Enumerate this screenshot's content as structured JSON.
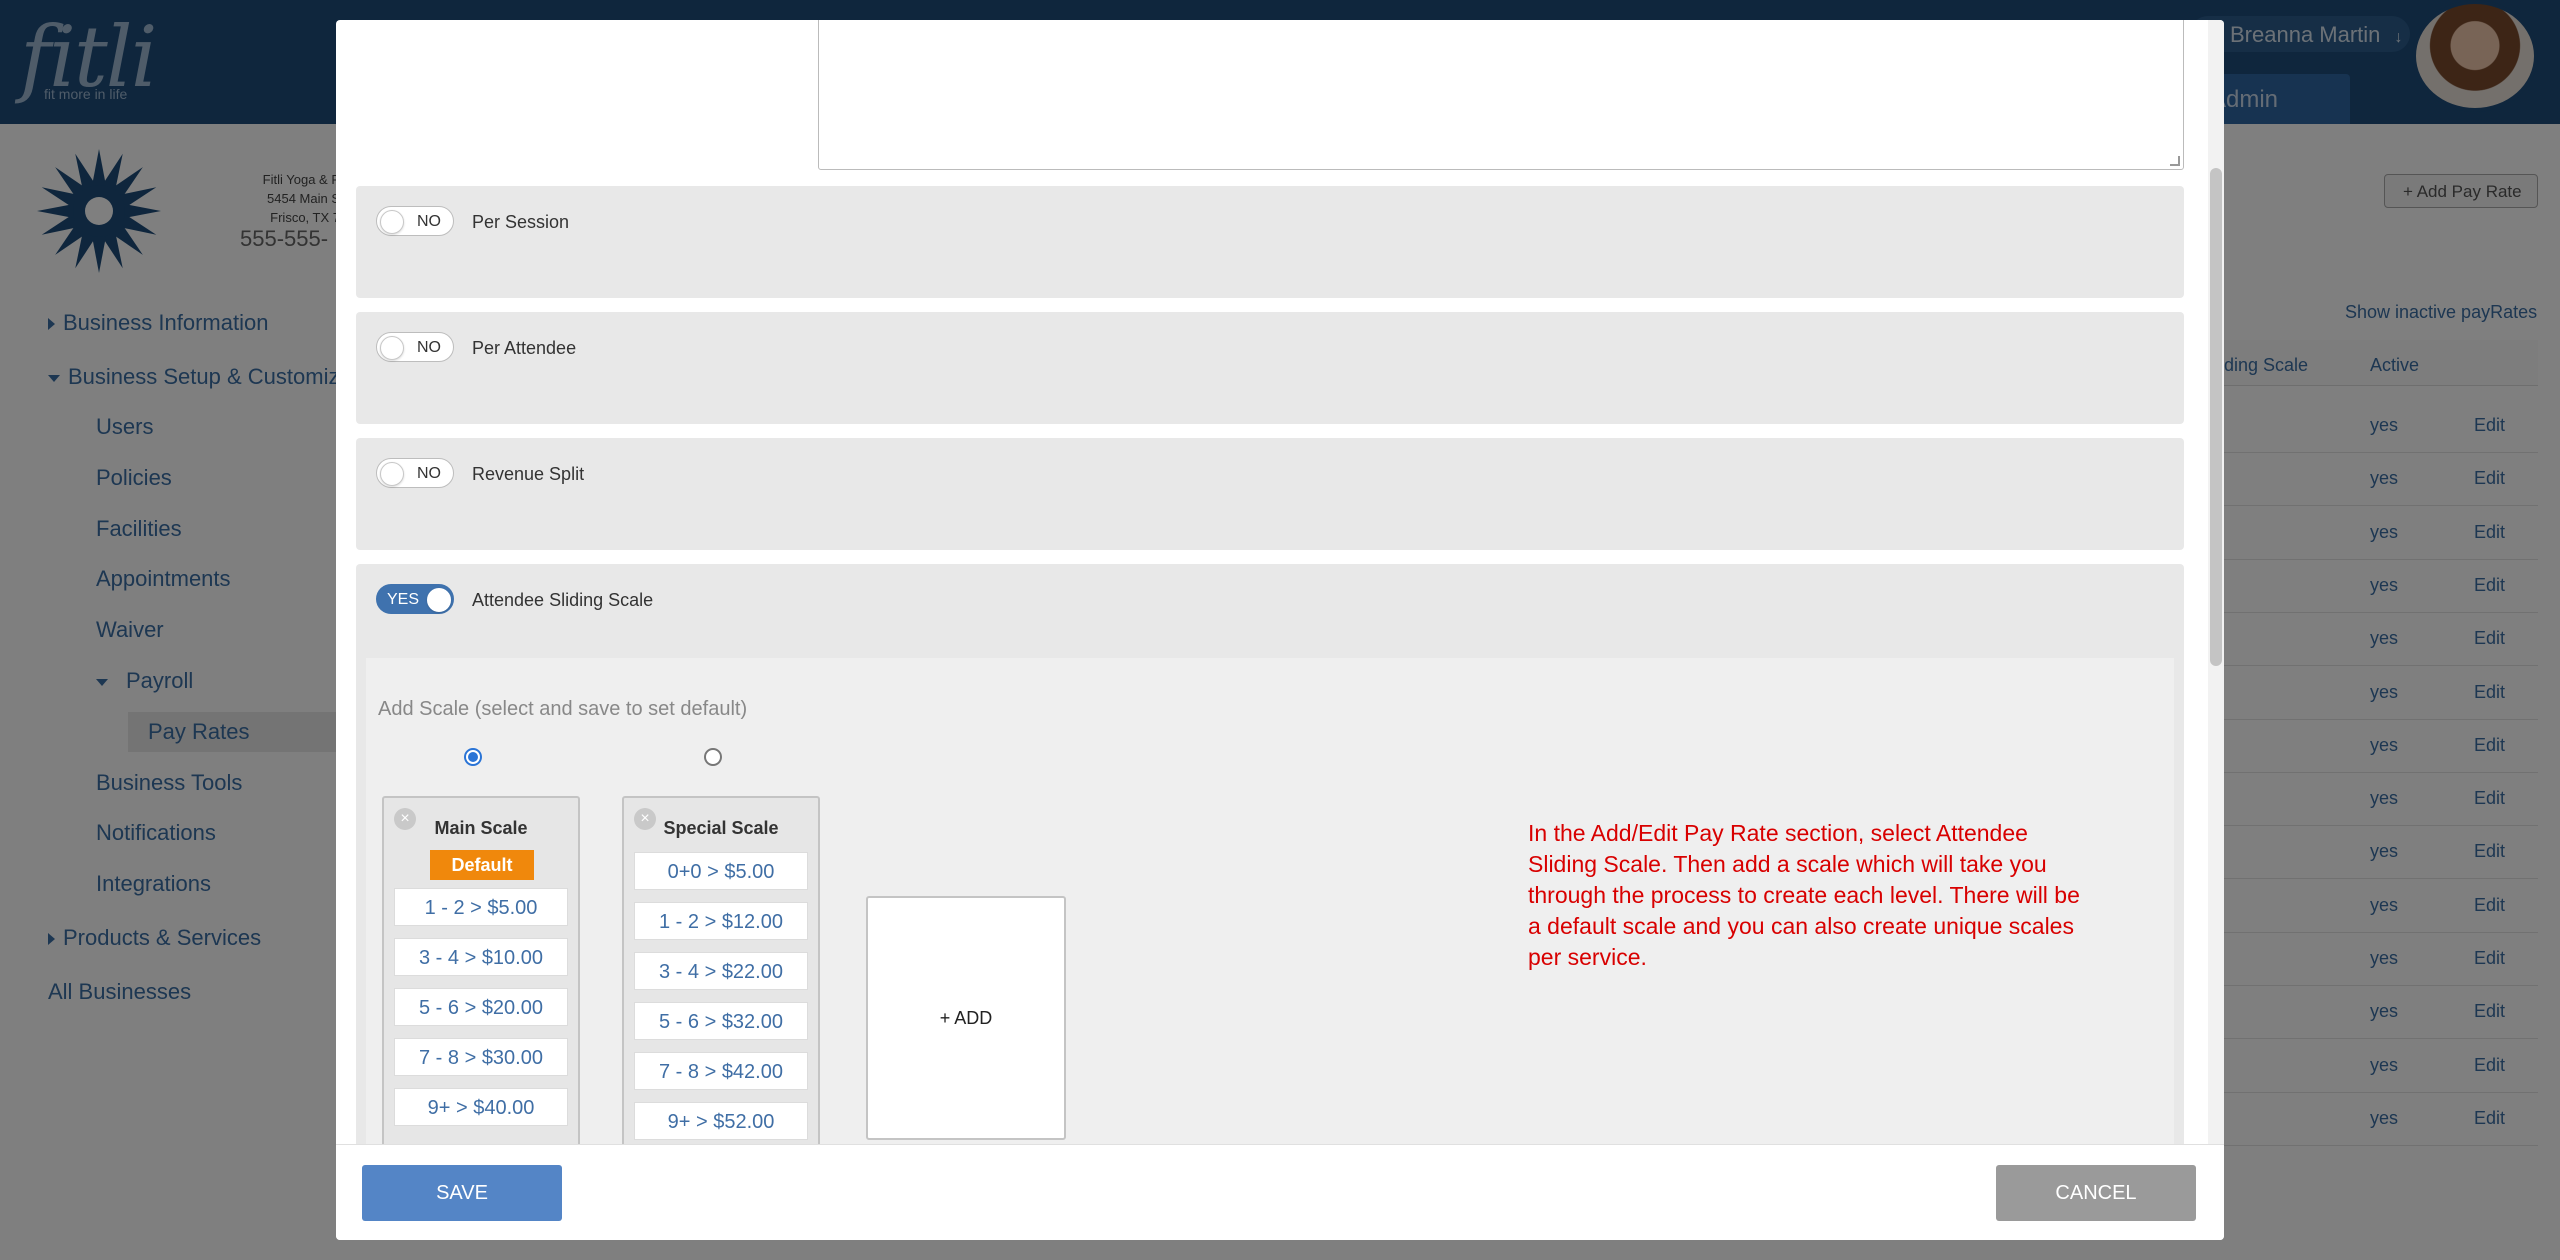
{
  "brand": {
    "logo": "fitli",
    "tagline": "fit more in life"
  },
  "header": {
    "user_name": "Breanna Martin",
    "admin_label": "Admin"
  },
  "business": {
    "name_line": "Fitli Yoga & P",
    "address1": "5454 Main S",
    "address2": "Frisco, TX 7",
    "phone": "555-555-"
  },
  "sidebar": {
    "items": [
      {
        "label": "Business Information"
      },
      {
        "label": "Business Setup & Customiza"
      },
      {
        "label": "Users"
      },
      {
        "label": "Policies"
      },
      {
        "label": "Facilities"
      },
      {
        "label": "Appointments"
      },
      {
        "label": "Waiver"
      },
      {
        "label": "Payroll"
      },
      {
        "label": "Pay Rates"
      },
      {
        "label": "Business Tools"
      },
      {
        "label": "Notifications"
      },
      {
        "label": "Integrations"
      },
      {
        "label": "Products & Services"
      },
      {
        "label": "All Businesses"
      }
    ]
  },
  "background_table": {
    "add_button": "+ Add Pay Rate",
    "show_inactive": "Show inactive payRates",
    "col_scale": "ding Scale",
    "col_active": "Active",
    "rows": [
      {
        "active": "yes",
        "action": "Edit"
      },
      {
        "active": "yes",
        "action": "Edit"
      },
      {
        "active": "yes",
        "action": "Edit"
      },
      {
        "active": "yes",
        "action": "Edit"
      },
      {
        "active": "yes",
        "action": "Edit"
      },
      {
        "active": "yes",
        "action": "Edit"
      },
      {
        "active": "yes",
        "action": "Edit"
      },
      {
        "active": "yes",
        "action": "Edit"
      },
      {
        "active": "yes",
        "action": "Edit"
      },
      {
        "active": "yes",
        "action": "Edit"
      },
      {
        "active": "yes",
        "action": "Edit"
      },
      {
        "active": "yes",
        "action": "Edit"
      },
      {
        "active": "yes",
        "action": "Edit"
      },
      {
        "active": "yes",
        "action": "Edit"
      }
    ]
  },
  "modal": {
    "options": [
      {
        "state": "NO",
        "label": "Per Session"
      },
      {
        "state": "NO",
        "label": "Per Attendee"
      },
      {
        "state": "NO",
        "label": "Revenue Split"
      },
      {
        "state": "YES",
        "label": "Attendee Sliding Scale"
      }
    ],
    "add_scale_label": "Add Scale (select and save to set default)",
    "scales": [
      {
        "title": "Main Scale",
        "badge": "Default",
        "levels": [
          "1 - 2 > $5.00",
          "3 - 4 > $10.00",
          "5 - 6 > $20.00",
          "7 - 8 > $30.00",
          "9+ > $40.00"
        ]
      },
      {
        "title": "Special Scale",
        "levels": [
          "0+0 > $5.00",
          "1 - 2 > $12.00",
          "3 - 4 > $22.00",
          "5 - 6 > $32.00",
          "7 - 8 > $42.00",
          "9+ > $52.00"
        ]
      }
    ],
    "add_label": "+ ADD",
    "note": "In the Add/Edit Pay Rate section, select Attendee Sliding Scale. Then add a scale which will take you through the process to create each level.  There will be a default scale and you can also create unique scales per service.",
    "save_label": "SAVE",
    "cancel_label": "CANCEL"
  },
  "colors": {
    "header_bg": "#1e4d7b",
    "accent_blue": "#3f72ae",
    "save_button": "#5485c6",
    "cancel_button": "#9a9a9a",
    "default_badge": "#f0880c",
    "note_text": "#d80000"
  }
}
